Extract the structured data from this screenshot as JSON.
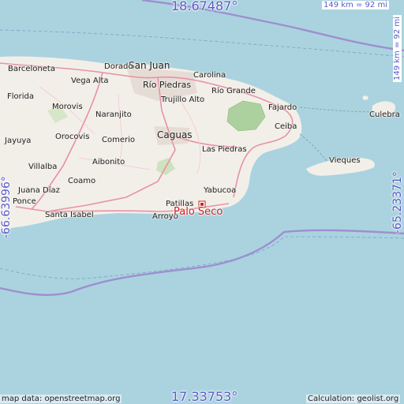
{
  "map": {
    "place_labels": [
      "San Juan",
      "Dorado",
      "Barceloneta",
      "Vega Alta",
      "Río Piedras",
      "Carolina",
      "Trujillo Alto",
      "Río Grande",
      "Fajardo",
      "Culebra",
      "Florida",
      "Morovis",
      "Naranjito",
      "Ceiba",
      "Jayuya",
      "Orocovis",
      "Comerio",
      "Caguas",
      "Las Piedras",
      "Vieques",
      "Villalba",
      "Aibonito",
      "Coamo",
      "Juana Díaz",
      "Santa Isabel",
      "Yabucoa",
      "Patillas",
      "Arroyo",
      "Ponce"
    ],
    "marker": {
      "label": "Palo Seco",
      "color": "#d02020"
    },
    "coords": {
      "top": "18.67487°",
      "bottom": "17.33753°",
      "left": "-66.63996°",
      "right": "-65.23371°"
    },
    "scale": {
      "top": "149 km = 92 mi",
      "right": "149 km = 92 mi"
    },
    "credits": {
      "map_data": "map data: openstreetmap.org",
      "calculation": "Calculation: geolist.org"
    },
    "colors": {
      "water": "#aad3df",
      "land": "#f2efe9",
      "forest": "#add19e",
      "road": "#e892a2",
      "boundary": "#9e8fcf",
      "coord": "#5a5ac8"
    }
  }
}
